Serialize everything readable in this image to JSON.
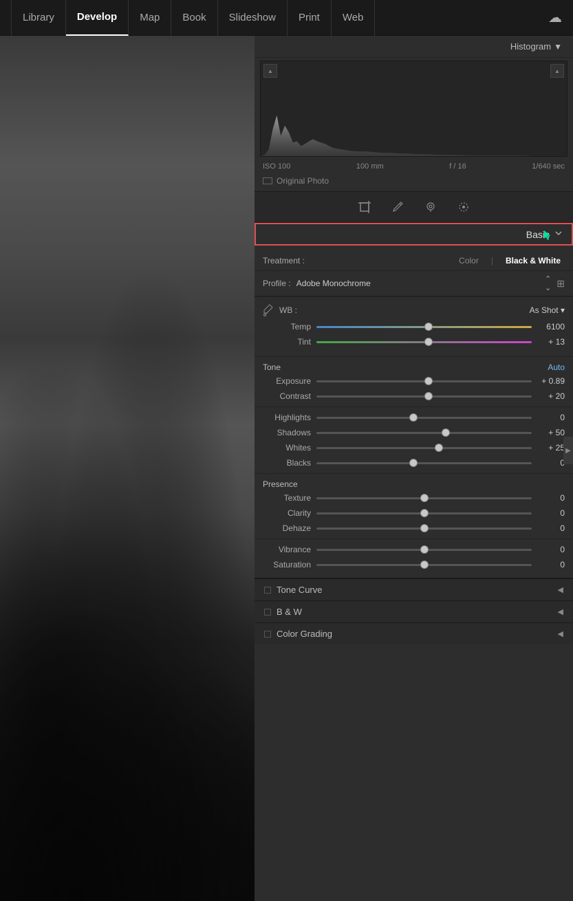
{
  "nav": {
    "items": [
      {
        "label": "Library",
        "active": false
      },
      {
        "label": "Develop",
        "active": true
      },
      {
        "label": "Map",
        "active": false
      },
      {
        "label": "Book",
        "active": false
      },
      {
        "label": "Slideshow",
        "active": false
      },
      {
        "label": "Print",
        "active": false
      },
      {
        "label": "Web",
        "active": false
      }
    ],
    "cloud_icon": "☁"
  },
  "histogram": {
    "title": "Histogram",
    "dropdown_icon": "▼",
    "meta": {
      "iso": "ISO 100",
      "focal": "100 mm",
      "aperture": "f / 16",
      "shutter": "1/640 sec"
    },
    "original_photo": "Original Photo",
    "corner_left": "▲",
    "corner_right": "▲"
  },
  "toolbar": {
    "icons": [
      "crop",
      "brush",
      "heal",
      "radial"
    ]
  },
  "basic": {
    "title": "Basic",
    "arrow": "▼",
    "treatment": {
      "label": "Treatment :",
      "options": [
        "Color",
        "Black & White"
      ],
      "active": "Black & White"
    },
    "profile": {
      "label": "Profile :",
      "value": "Adobe Monochrome",
      "grid_icon": "⊞"
    },
    "wb": {
      "label": "WB :",
      "value": "As Shot ▾"
    },
    "sliders": [
      {
        "label": "Temp",
        "value": "6100",
        "pct": 52,
        "type": "temp"
      },
      {
        "label": "Tint",
        "value": "+ 13",
        "pct": 52,
        "type": "tint"
      },
      {
        "label": "Exposure",
        "value": "+ 0.89",
        "pct": 52,
        "type": "gray"
      },
      {
        "label": "Contrast",
        "value": "+ 20",
        "pct": 52,
        "type": "gray"
      },
      {
        "label": "Highlights",
        "value": "0",
        "pct": 45,
        "type": "gray"
      },
      {
        "label": "Shadows",
        "value": "+ 50",
        "pct": 60,
        "type": "gray"
      },
      {
        "label": "Whites",
        "value": "+ 25",
        "pct": 57,
        "type": "gray"
      },
      {
        "label": "Blacks",
        "value": "0",
        "pct": 45,
        "type": "gray"
      }
    ],
    "tone_label": "Tone",
    "auto_label": "Auto",
    "presence_label": "Presence",
    "presence_sliders": [
      {
        "label": "Texture",
        "value": "0",
        "pct": 50
      },
      {
        "label": "Clarity",
        "value": "0",
        "pct": 50
      },
      {
        "label": "Dehaze",
        "value": "0",
        "pct": 50
      },
      {
        "label": "Vibrance",
        "value": "0",
        "pct": 50
      },
      {
        "label": "Saturation",
        "value": "0",
        "pct": 50
      }
    ]
  },
  "collapsed_sections": [
    {
      "title": "Tone Curve",
      "arrow": "◀"
    },
    {
      "title": "B & W",
      "arrow": "◀"
    },
    {
      "title": "Color Grading",
      "arrow": "◀"
    }
  ]
}
